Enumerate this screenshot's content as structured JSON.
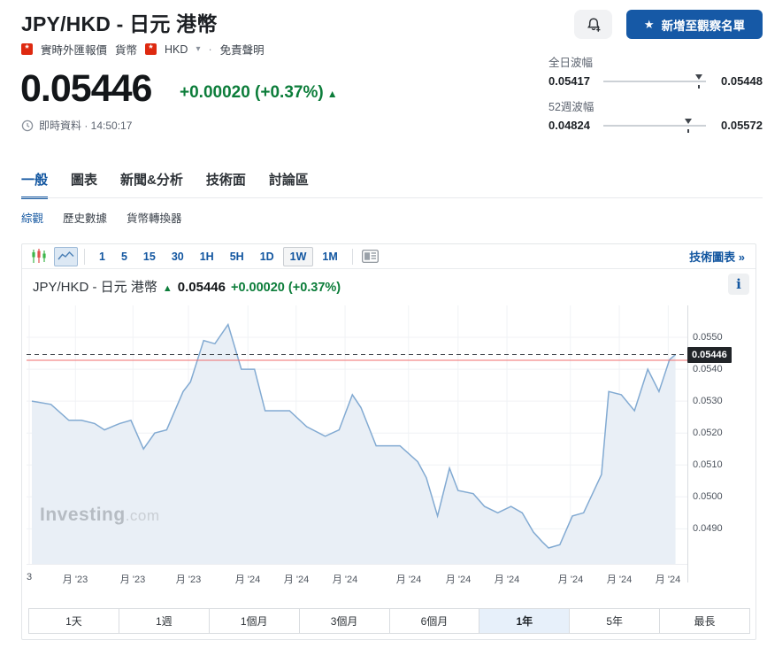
{
  "colors": {
    "accent_blue": "#1256a0",
    "button_blue": "#1659a6",
    "green_up": "#0c7d3a",
    "flag_red": "#de2910",
    "chart_line": "#82aad2",
    "chart_fill": "#e9eff6",
    "prev_close_red": "#f06e6e",
    "dashed_price": "#41464c",
    "badge_bg": "#212428"
  },
  "header": {
    "title": "JPY/HKD - 日元 港幣",
    "breadcrumb": [
      "實時外匯報價",
      "貨幣",
      "HKD"
    ],
    "chevron": "▾",
    "sep": "·",
    "disclaimer": "免責聲明",
    "flag_glyph": "*",
    "watchlist_label": "新增至觀察名單",
    "watchlist_star": "★"
  },
  "quote": {
    "price": "0.05446",
    "change": "+0.00020 (+0.37%)",
    "arrow_up": "▲",
    "status": "即時資料 · 14:50:17"
  },
  "ranges": [
    {
      "label": "全日波幅",
      "low": "0.05417",
      "high": "0.05448",
      "pos_pct": 93
    },
    {
      "label": "52週波幅",
      "low": "0.04824",
      "high": "0.05572",
      "pos_pct": 83
    }
  ],
  "tabs": {
    "items": [
      "一般",
      "圖表",
      "新聞&分析",
      "技術面",
      "討論區"
    ],
    "active": 0
  },
  "subtabs": {
    "items": [
      "綜觀",
      "歷史數據",
      "貨幣轉換器"
    ],
    "active": 0
  },
  "toolbar": {
    "intervals": [
      "1",
      "5",
      "15",
      "30",
      "1H",
      "5H",
      "1D",
      "1W",
      "1M"
    ],
    "active_interval": "1W",
    "tech_chart_link": "技術圖表 »"
  },
  "chart_header": {
    "name": "JPY/HKD - 日元 港幣",
    "arrow": "▲",
    "price": "0.05446",
    "change": "+0.00020 (+0.37%)",
    "info_glyph": "i"
  },
  "watermark": {
    "main": "Investing",
    "suffix": ".com"
  },
  "chart_data": {
    "type": "area",
    "ylim": [
      0.0479,
      0.056
    ],
    "y_ticks": [
      {
        "value": 0.055,
        "label": "0.0550"
      },
      {
        "value": 0.054,
        "label": "0.0540"
      },
      {
        "value": 0.053,
        "label": "0.0530"
      },
      {
        "value": 0.052,
        "label": "0.0520"
      },
      {
        "value": 0.051,
        "label": "0.0510"
      },
      {
        "value": 0.05,
        "label": "0.0500"
      },
      {
        "value": 0.049,
        "label": "0.0490"
      }
    ],
    "x_ticks": [
      {
        "frac": 0.004,
        "label": "3"
      },
      {
        "frac": 0.074,
        "label": "月 '23"
      },
      {
        "frac": 0.161,
        "label": "月 '23"
      },
      {
        "frac": 0.245,
        "label": "月 '23"
      },
      {
        "frac": 0.335,
        "label": "月 '24"
      },
      {
        "frac": 0.408,
        "label": "月 '24"
      },
      {
        "frac": 0.482,
        "label": "月 '24"
      },
      {
        "frac": 0.578,
        "label": "月 '24"
      },
      {
        "frac": 0.653,
        "label": "月 '24"
      },
      {
        "frac": 0.727,
        "label": "月 '24"
      },
      {
        "frac": 0.823,
        "label": "月 '24"
      },
      {
        "frac": 0.897,
        "label": "月 '24"
      },
      {
        "frac": 0.971,
        "label": "月 '24"
      }
    ],
    "current_price": 0.05446,
    "current_price_label": "0.05446",
    "prev_close": 0.05428,
    "grid": true,
    "points": [
      [
        0.008,
        0.053
      ],
      [
        0.037,
        0.0529
      ],
      [
        0.064,
        0.0524
      ],
      [
        0.083,
        0.0524
      ],
      [
        0.103,
        0.0523
      ],
      [
        0.118,
        0.0521
      ],
      [
        0.141,
        0.0523
      ],
      [
        0.158,
        0.0524
      ],
      [
        0.177,
        0.0515
      ],
      [
        0.194,
        0.052
      ],
      [
        0.212,
        0.0521
      ],
      [
        0.237,
        0.0533
      ],
      [
        0.248,
        0.0536
      ],
      [
        0.268,
        0.0549
      ],
      [
        0.285,
        0.0548
      ],
      [
        0.305,
        0.0554
      ],
      [
        0.325,
        0.054
      ],
      [
        0.345,
        0.054
      ],
      [
        0.361,
        0.0527
      ],
      [
        0.398,
        0.0527
      ],
      [
        0.424,
        0.0522
      ],
      [
        0.452,
        0.0519
      ],
      [
        0.473,
        0.0521
      ],
      [
        0.493,
        0.0532
      ],
      [
        0.506,
        0.0528
      ],
      [
        0.529,
        0.0516
      ],
      [
        0.565,
        0.0516
      ],
      [
        0.592,
        0.0511
      ],
      [
        0.605,
        0.0506
      ],
      [
        0.622,
        0.0494
      ],
      [
        0.64,
        0.0509
      ],
      [
        0.653,
        0.0502
      ],
      [
        0.676,
        0.0501
      ],
      [
        0.693,
        0.0497
      ],
      [
        0.713,
        0.0495
      ],
      [
        0.733,
        0.0497
      ],
      [
        0.75,
        0.0495
      ],
      [
        0.767,
        0.0489
      ],
      [
        0.78,
        0.0486
      ],
      [
        0.79,
        0.0484
      ],
      [
        0.807,
        0.0485
      ],
      [
        0.826,
        0.0494
      ],
      [
        0.843,
        0.0495
      ],
      [
        0.87,
        0.0507
      ],
      [
        0.881,
        0.0533
      ],
      [
        0.9,
        0.0532
      ],
      [
        0.92,
        0.0527
      ],
      [
        0.94,
        0.054
      ],
      [
        0.957,
        0.0533
      ],
      [
        0.973,
        0.0543
      ],
      [
        0.982,
        0.05446
      ]
    ]
  },
  "range_buttons": {
    "items": [
      "1天",
      "1週",
      "1個月",
      "3個月",
      "6個月",
      "1年",
      "5年",
      "最長"
    ],
    "active": 5
  }
}
